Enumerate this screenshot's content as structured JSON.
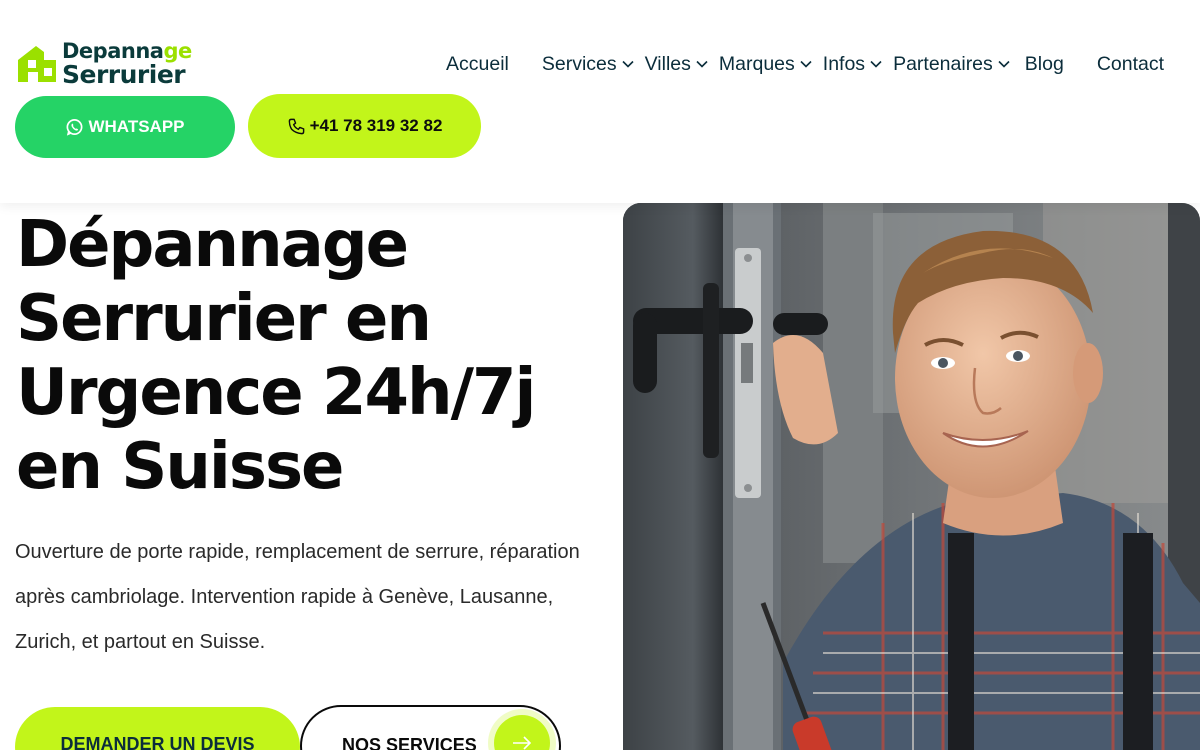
{
  "brand": {
    "line1_a": "Depanna",
    "line1_b": "ge",
    "line2": "Serrurier"
  },
  "nav": [
    "Accueil",
    "Services",
    "Villes",
    "Marques",
    "Infos",
    "Partenaires",
    "Blog",
    "Contact"
  ],
  "contact": {
    "whatsapp_label": "WHATSAPP",
    "phone_label": "+41 78 319 32 82"
  },
  "hero": {
    "title": "Dépannage Serrurier en Urgence 24h/7j en Suisse",
    "description": "Ouverture de porte rapide, remplacement de serrure, réparation après cambriolage. Intervention rapide à Genève, Lausanne, Zurich, et partout en Suisse.",
    "cta_primary": "DEMANDER UN DEVIS",
    "cta_secondary": "NOS SERVICES"
  },
  "colors": {
    "accent": "#c2f51a",
    "whatsapp": "#25d366",
    "brand_dark": "#0b3b3b",
    "logo_green": "#9be000"
  },
  "icons": {
    "whatsapp": "whatsapp-icon",
    "phone": "phone-icon",
    "arrow": "arrow-right-icon",
    "chevron": "chevron-down-icon"
  }
}
